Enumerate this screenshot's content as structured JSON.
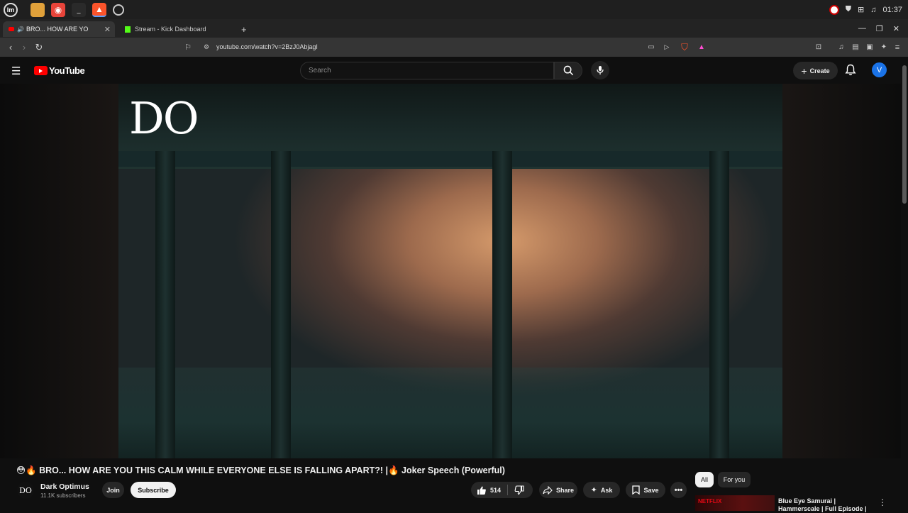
{
  "taskbar": {
    "time": "01:37"
  },
  "tabs": [
    {
      "label": "BRO... HOW ARE YO"
    },
    {
      "label": "Stream - Kick Dashboard"
    }
  ],
  "address": {
    "url": "youtube.com/watch?v=2BzJ0AbjagI"
  },
  "header": {
    "logo_text": "YouTube",
    "search_placeholder": "Search",
    "create_label": "Create",
    "avatar_letter": "V"
  },
  "video": {
    "watermark": "DO",
    "title": "😳🔥 BRO... HOW ARE YOU THIS CALM WHILE EVERYONE ELSE IS FALLING APART?! |🔥 Joker Speech (Powerful)"
  },
  "channel": {
    "name": "Dark Optimus",
    "subscribers": "11.1K subscribers",
    "avatar_text": "DO",
    "join_label": "Join",
    "subscribe_label": "Subscribe"
  },
  "actions": {
    "likes": "514",
    "share_label": "Share",
    "ask_label": "Ask",
    "save_label": "Save"
  },
  "chips": [
    {
      "label": "All"
    },
    {
      "label": "For you"
    }
  ],
  "recommendation": {
    "badge": "NETFLIX",
    "title": "Blue Eye Samurai | Hammerscale | Full Episode |"
  },
  "colors": {
    "youtube_red": "#ff0000",
    "avatar_blue": "#1a73e8",
    "netflix_red": "#e50914"
  }
}
